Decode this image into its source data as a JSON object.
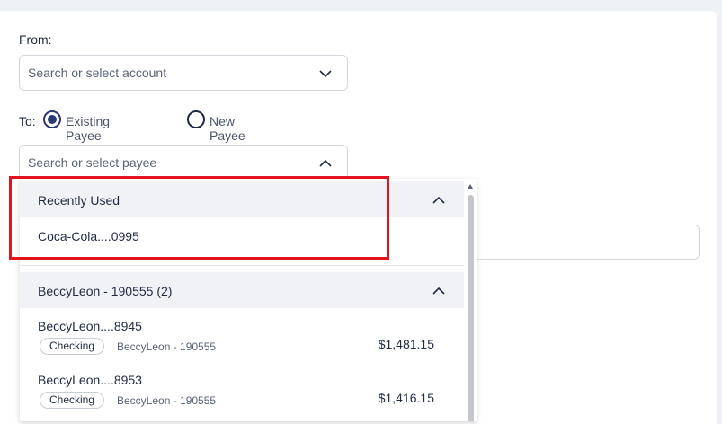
{
  "from": {
    "label": "From:",
    "placeholder": "Search or select account"
  },
  "to": {
    "label": "To:",
    "options": [
      {
        "label": "Existing Payee",
        "selected": true
      },
      {
        "label": "New Payee",
        "selected": false
      }
    ],
    "placeholder": "Search or select payee"
  },
  "dropdown": {
    "groups": [
      {
        "title": "Recently Used",
        "items": [
          {
            "name": "Coca-Cola....0995"
          }
        ]
      },
      {
        "title": "BeccyLeon - 190555 (2)",
        "items": [
          {
            "name": "BeccyLeon....8945",
            "type": "Checking",
            "owner": "BeccyLeon - 190555",
            "amount": "$1,481.15"
          },
          {
            "name": "BeccyLeon....8953",
            "type": "Checking",
            "owner": "BeccyLeon - 190555",
            "amount": "$1,416.15"
          }
        ]
      }
    ]
  },
  "colors": {
    "accent": "#2c3a73",
    "highlight": "#e0131f"
  }
}
